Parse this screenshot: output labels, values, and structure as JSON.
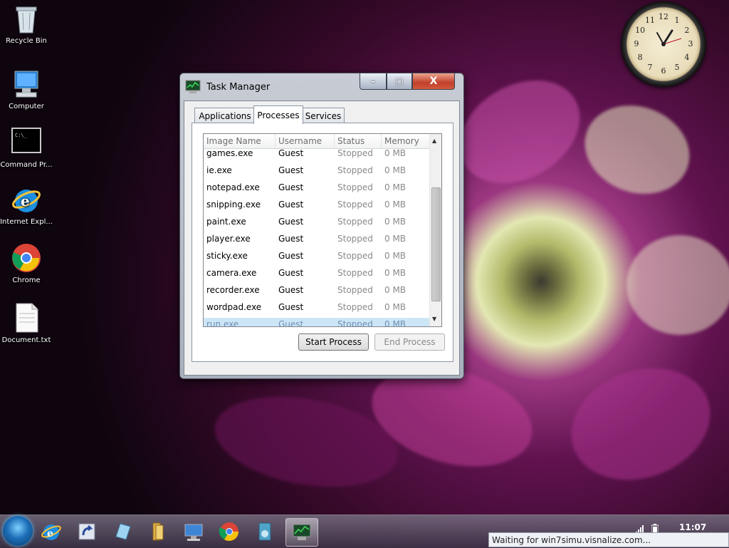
{
  "desktop": {
    "icons": [
      {
        "label": "Recycle Bin"
      },
      {
        "label": "Computer"
      },
      {
        "label": "Command Pr..."
      },
      {
        "label": "Internet Expl..."
      },
      {
        "label": "Chrome"
      },
      {
        "label": "Document.txt"
      }
    ]
  },
  "clock_gadget": {
    "numbers": [
      "12",
      "1",
      "2",
      "3",
      "4",
      "5",
      "6",
      "7",
      "8",
      "9",
      "10",
      "11"
    ]
  },
  "task_manager": {
    "title": "Task Manager",
    "buttons": {
      "minimize": "–",
      "maximize": "□",
      "close": "X"
    },
    "tabs": [
      {
        "label": "Applications",
        "active": false
      },
      {
        "label": "Processes",
        "active": true
      },
      {
        "label": "Services",
        "active": false
      }
    ],
    "columns": [
      "Image Name",
      "Username",
      "Status",
      "Memory"
    ],
    "rows": [
      {
        "name": "games.exe",
        "user": "Guest",
        "status": "Stopped",
        "memory": "0 MB"
      },
      {
        "name": "ie.exe",
        "user": "Guest",
        "status": "Stopped",
        "memory": "0 MB"
      },
      {
        "name": "notepad.exe",
        "user": "Guest",
        "status": "Stopped",
        "memory": "0 MB"
      },
      {
        "name": "snipping.exe",
        "user": "Guest",
        "status": "Stopped",
        "memory": "0 MB"
      },
      {
        "name": "paint.exe",
        "user": "Guest",
        "status": "Stopped",
        "memory": "0 MB"
      },
      {
        "name": "player.exe",
        "user": "Guest",
        "status": "Stopped",
        "memory": "0 MB"
      },
      {
        "name": "sticky.exe",
        "user": "Guest",
        "status": "Stopped",
        "memory": "0 MB"
      },
      {
        "name": "camera.exe",
        "user": "Guest",
        "status": "Stopped",
        "memory": "0 MB"
      },
      {
        "name": "recorder.exe",
        "user": "Guest",
        "status": "Stopped",
        "memory": "0 MB"
      },
      {
        "name": "wordpad.exe",
        "user": "Guest",
        "status": "Stopped",
        "memory": "0 MB"
      },
      {
        "name": "run.exe",
        "user": "Guest",
        "status": "Stopped",
        "memory": "0 MB"
      }
    ],
    "start_process": "Start Process",
    "end_process": "End Process"
  },
  "taskbar": {
    "pinned": [
      "start-orb-icon",
      "internet-explorer-icon",
      "shortcut-icon",
      "glass-icon",
      "file-explorer-icon",
      "control-panel-icon",
      "chrome-icon",
      "media-icon",
      "task-manager-icon"
    ],
    "time": "11:07"
  },
  "status_popup": {
    "text": "Waiting for win7simu.visnalize.com..."
  }
}
